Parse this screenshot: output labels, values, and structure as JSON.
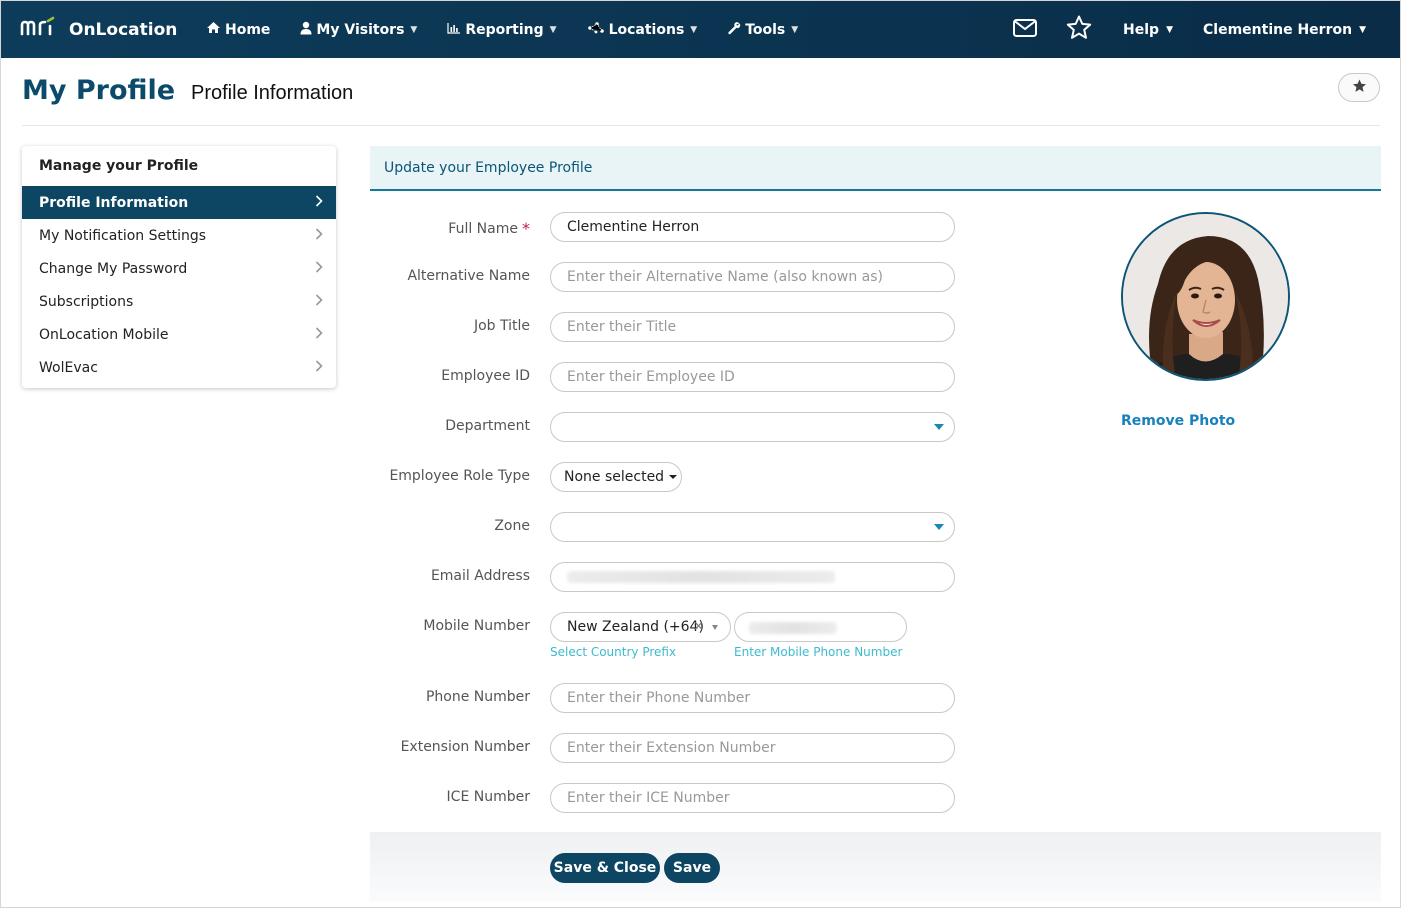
{
  "nav": {
    "brand_mark": "mri",
    "brand_name": "OnLocation",
    "items": [
      {
        "label": "Home",
        "icon": "home-icon",
        "caret": false
      },
      {
        "label": "My Visitors",
        "icon": "user-icon",
        "caret": true
      },
      {
        "label": "Reporting",
        "icon": "chart-icon",
        "caret": true
      },
      {
        "label": "Locations",
        "icon": "network-icon",
        "caret": true
      },
      {
        "label": "Tools",
        "icon": "wrench-icon",
        "caret": true
      }
    ],
    "help_label": "Help",
    "user_label": "Clementine Herron"
  },
  "page": {
    "title": "My Profile",
    "subtitle": "Profile Information"
  },
  "sidebar": {
    "heading": "Manage your Profile",
    "items": [
      {
        "label": "Profile Information",
        "active": true
      },
      {
        "label": "My Notification Settings",
        "active": false
      },
      {
        "label": "Change My Password",
        "active": false
      },
      {
        "label": "Subscriptions",
        "active": false
      },
      {
        "label": "OnLocation Mobile",
        "active": false
      },
      {
        "label": "WolEvac",
        "active": false
      }
    ]
  },
  "form": {
    "header": "Update your Employee Profile",
    "full_name": {
      "label": "Full Name",
      "value": "Clementine Herron",
      "required_mark": "*"
    },
    "alternative_name": {
      "label": "Alternative Name",
      "placeholder": "Enter their Alternative Name (also known as)"
    },
    "job_title": {
      "label": "Job Title",
      "placeholder": "Enter their Title"
    },
    "employee_id": {
      "label": "Employee ID",
      "placeholder": "Enter their Employee ID"
    },
    "department": {
      "label": "Department",
      "value": ""
    },
    "employee_role_type": {
      "label": "Employee Role Type",
      "value": "None selected"
    },
    "zone": {
      "label": "Zone",
      "value": ""
    },
    "email": {
      "label": "Email Address"
    },
    "mobile": {
      "label": "Mobile Number",
      "country_value": "New Zealand (+64)",
      "clear_glyph": "×",
      "country_hint": "Select Country Prefix",
      "number_hint": "Enter Mobile Phone Number"
    },
    "phone": {
      "label": "Phone Number",
      "placeholder": "Enter their Phone Number"
    },
    "extension": {
      "label": "Extension Number",
      "placeholder": "Enter their Extension Number"
    },
    "ice": {
      "label": "ICE Number",
      "placeholder": "Enter their ICE Number"
    }
  },
  "photo": {
    "remove_label": "Remove Photo"
  },
  "actions": {
    "save_close_label": "Save & Close",
    "save_label": "Save"
  },
  "colors": {
    "nav_bg": "#0d3c5a",
    "brand_accent": "#9bc33c",
    "active_item": "#0d4662",
    "link": "#1780bd",
    "hint": "#3dbad0",
    "required": "#c1185c"
  }
}
